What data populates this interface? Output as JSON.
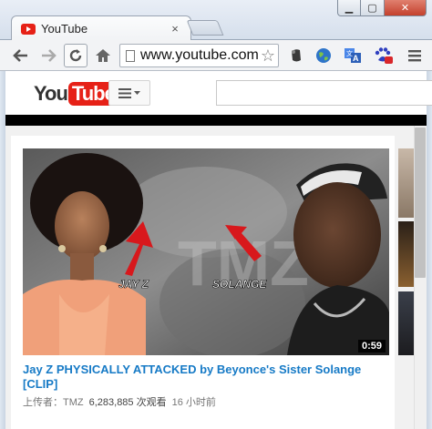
{
  "browser": {
    "tab_title": "YouTube",
    "tab_close": "×",
    "url": "www.youtube.com",
    "window_controls": {
      "minimize": "▁",
      "maximize": "▢",
      "close": "✕"
    }
  },
  "youtube": {
    "logo_you": "You",
    "logo_tube": "Tube",
    "guide_button": "≡ ▾",
    "search_placeholder": ""
  },
  "video": {
    "title": "Jay Z PHYSICALLY ATTACKED by Beyonce's Sister Solange [CLIP]",
    "uploader_label": "上传者：TMZ",
    "views": "6,283,885 次观看",
    "age": "16 小时前",
    "duration": "0:59",
    "overlay_labels": [
      "JAY Z",
      "SOLANGE"
    ],
    "watermark": "TMZ"
  },
  "colors": {
    "brand_red": "#e62117",
    "link_blue": "#167ac6",
    "meta_gray": "#767676"
  },
  "icons": [
    "back-arrow-icon",
    "forward-arrow-icon",
    "reload-icon",
    "home-icon",
    "page-icon",
    "bookmark-star-icon",
    "extension-evernote-icon",
    "extension-globe-icon",
    "extension-translate-icon",
    "extension-baidu-icon",
    "menu-icon"
  ]
}
